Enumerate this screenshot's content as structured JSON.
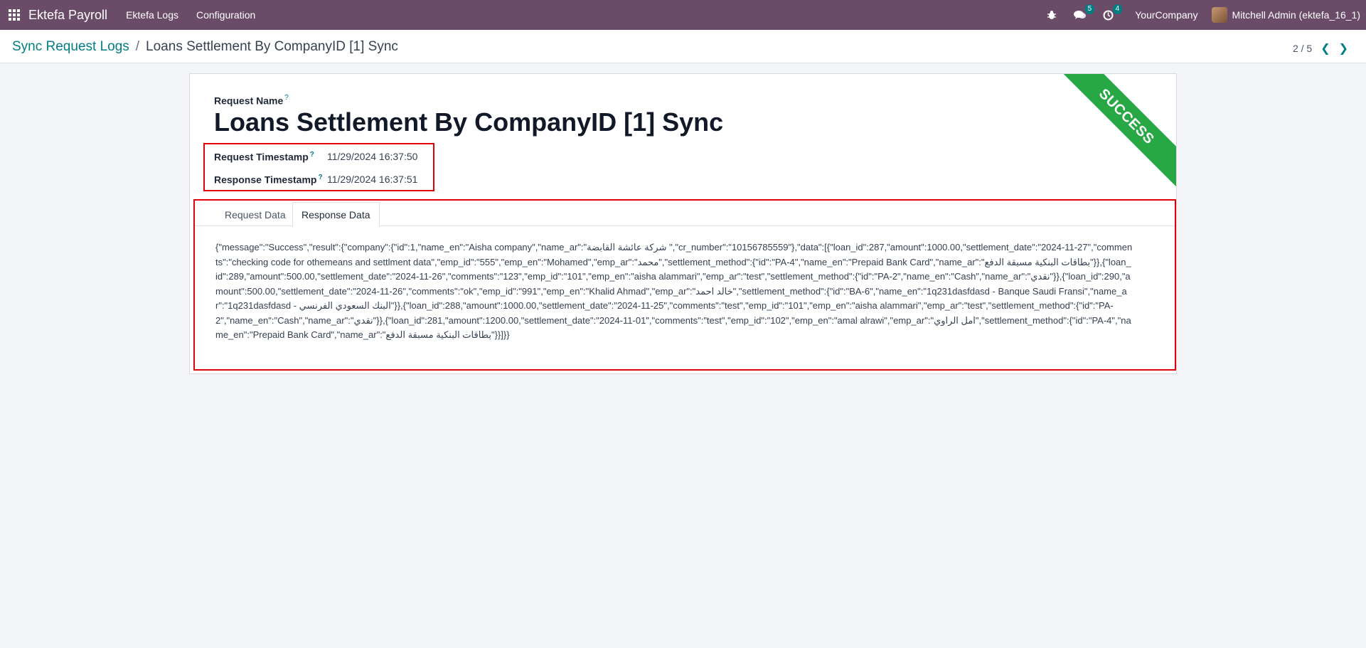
{
  "navbar": {
    "apps_icon": "apps-grid-icon",
    "brand": "Ektefa Payroll",
    "menu": [
      "Ektefa Logs",
      "Configuration"
    ],
    "messages_badge": "5",
    "activities_badge": "4",
    "company": "YourCompany",
    "user": "Mitchell Admin (ektefa_16_1)"
  },
  "breadcrumb": {
    "parent": "Sync Request Logs",
    "separator": "/",
    "current": "Loans Settlement By CompanyID [1] Sync"
  },
  "pager": {
    "value": "2 / 5"
  },
  "form": {
    "ribbon": "SUCCESS",
    "request_name_label": "Request Name",
    "help_mark": "?",
    "request_name": "Loans Settlement By CompanyID [1] Sync",
    "request_timestamp_label": "Request Timestamp",
    "request_timestamp": "11/29/2024 16:37:50",
    "response_timestamp_label": "Response Timestamp",
    "response_timestamp": "11/29/2024 16:37:51",
    "tabs": [
      "Request Data",
      "Response Data"
    ],
    "active_tab": "Response Data",
    "response_data": "{\"message\":\"Success\",\"result\":{\"company\":{\"id\":1,\"name_en\":\"Aisha company\",\"name_ar\":\"شركة عائشة القابضة \",\"cr_number\":\"10156785559\"},\"data\":[{\"loan_id\":287,\"amount\":1000.00,\"settlement_date\":\"2024-11-27\",\"comments\":\"checking code for othemeans and settlment data\",\"emp_id\":\"555\",\"emp_en\":\"Mohamed\",\"emp_ar\":\"محمد\",\"settlement_method\":{\"id\":\"PA-4\",\"name_en\":\"Prepaid Bank Card\",\"name_ar\":\"بطاقات البنكية مسبقة الدفع\"}},{\"loan_id\":289,\"amount\":500.00,\"settlement_date\":\"2024-11-26\",\"comments\":\"123\",\"emp_id\":\"101\",\"emp_en\":\"aisha alammari\",\"emp_ar\":\"test\",\"settlement_method\":{\"id\":\"PA-2\",\"name_en\":\"Cash\",\"name_ar\":\"نقدي\"}},{\"loan_id\":290,\"amount\":500.00,\"settlement_date\":\"2024-11-26\",\"comments\":\"ok\",\"emp_id\":\"991\",\"emp_en\":\"Khalid Ahmad\",\"emp_ar\":\"خالد احمد\",\"settlement_method\":{\"id\":\"BA-6\",\"name_en\":\"1q231dasfdasd - Banque Saudi Fransi\",\"name_ar\":\"1q231dasfdasd - البنك السعودي الفرنسي\"}},{\"loan_id\":288,\"amount\":1000.00,\"settlement_date\":\"2024-11-25\",\"comments\":\"test\",\"emp_id\":\"101\",\"emp_en\":\"aisha alammari\",\"emp_ar\":\"test\",\"settlement_method\":{\"id\":\"PA-2\",\"name_en\":\"Cash\",\"name_ar\":\"نقدي\"}},{\"loan_id\":281,\"amount\":1200.00,\"settlement_date\":\"2024-11-01\",\"comments\":\"test\",\"emp_id\":\"102\",\"emp_en\":\"amal alrawi\",\"emp_ar\":\"امل الراوي\",\"settlement_method\":{\"id\":\"PA-4\",\"name_en\":\"Prepaid Bank Card\",\"name_ar\":\"بطاقات البنكية مسبقة الدفع\"}}]}}"
  },
  "colors": {
    "navbar": "#6b4c68",
    "link": "#017e84",
    "ribbon": "#28a745",
    "highlight_border": "#e0000a",
    "background": "#f4f5f9"
  },
  "icons": {
    "bug": "bug-icon",
    "messages": "chat-bubbles-icon",
    "activities": "clock-icon",
    "pager_prev": "chevron-left-icon",
    "pager_next": "chevron-right-icon"
  }
}
